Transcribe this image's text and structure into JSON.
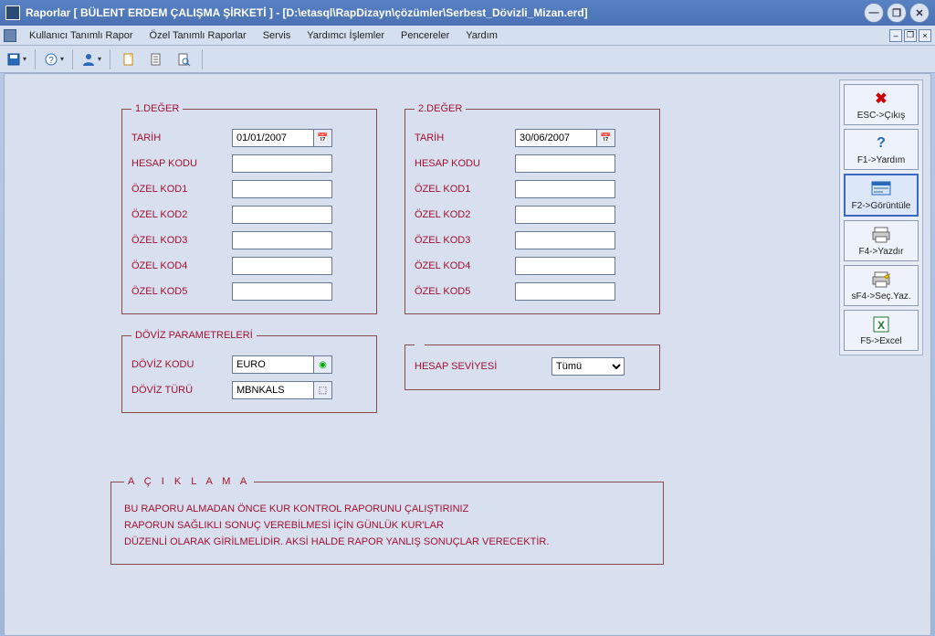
{
  "window": {
    "title": "Raporlar [ BÜLENT ERDEM ÇALIŞMA ŞİRKETİ ]  - [D:\\etasql\\RapDizayn\\çözümler\\Serbest_Dövizli_Mizan.erd]"
  },
  "menu": {
    "items": [
      "Kullanıcı Tanımlı Rapor",
      "Özel Tanımlı Raporlar",
      "Servis",
      "Yardımcı İşlemler",
      "Pencereler",
      "Yardım"
    ]
  },
  "group1": {
    "legend": "1.DEĞER",
    "tarih_lbl": "TARİH",
    "tarih_val": "01/01/2007",
    "hesap_lbl": "HESAP KODU",
    "ok1_lbl": "ÖZEL KOD1",
    "ok2_lbl": "ÖZEL KOD2",
    "ok3_lbl": "ÖZEL KOD3",
    "ok4_lbl": "ÖZEL KOD4",
    "ok5_lbl": "ÖZEL KOD5"
  },
  "group2": {
    "legend": "2.DEĞER",
    "tarih_lbl": "TARİH",
    "tarih_val": "30/06/2007",
    "hesap_lbl": "HESAP KODU",
    "ok1_lbl": "ÖZEL KOD1",
    "ok2_lbl": "ÖZEL KOD2",
    "ok3_lbl": "ÖZEL KOD3",
    "ok4_lbl": "ÖZEL KOD4",
    "ok5_lbl": "ÖZEL KOD5"
  },
  "doviz": {
    "legend": "DÖVİZ PARAMETRELERİ",
    "kod_lbl": "DÖVİZ KODU",
    "kod_val": "EURO",
    "tur_lbl": "DÖVİZ TÜRÜ",
    "tur_val": "MBNKALS"
  },
  "hesap": {
    "lbl": "HESAP SEVİYESİ",
    "selected": "Tümü"
  },
  "aciklama": {
    "legend": "A Ç I K L A M A",
    "l1": "BU RAPORU ALMADAN ÖNCE KUR KONTROL RAPORUNU ÇALIŞTIRINIZ",
    "l2": "RAPORUN SAĞLIKLI SONUÇ VEREBİLMESİ İÇİN GÜNLÜK KUR'LAR",
    "l3": "DÜZENLİ OLARAK GİRİLMELİDİR. AKSİ HALDE RAPOR YANLIŞ SONUÇLAR VERECEKTİR."
  },
  "side": {
    "esc": "ESC->Çıkış",
    "f1": "F1->Yardım",
    "f2": "F2->Görüntüle",
    "f4": "F4->Yazdır",
    "sf4": "sF4->Seç.Yaz.",
    "f5": "F5->Excel"
  }
}
